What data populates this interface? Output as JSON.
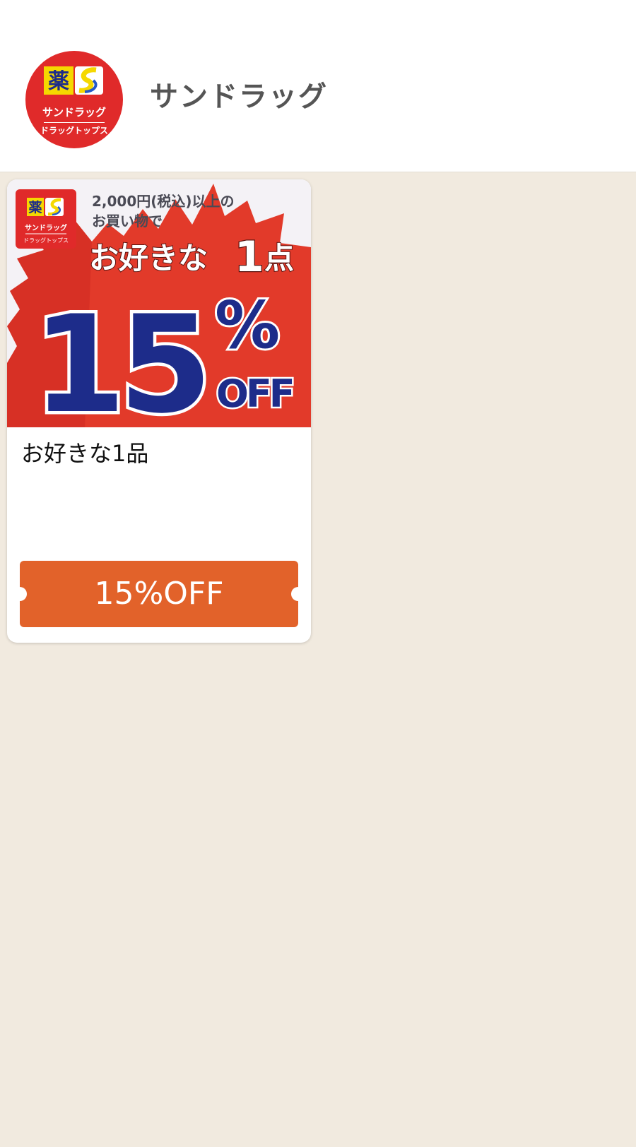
{
  "header": {
    "logo": {
      "kanji": "薬",
      "brand": "サンドラッグ",
      "sub_brand": "ドラッグトップス"
    },
    "store_name": "サンドラッグ"
  },
  "coupon": {
    "banner": {
      "condition_line1": "2,000円(税込)以上の",
      "condition_line2": "お買い物で",
      "headline": "お好きな",
      "headline_number": "1",
      "headline_suffix": "点",
      "discount_number": "15",
      "discount_percent": "%",
      "discount_off": "OFF",
      "logo_kanji": "薬",
      "logo_brand": "サンドラッグ",
      "logo_sub": "ドラッグトップス"
    },
    "title": "お好きな1品",
    "ticket_label": "15%OFF"
  },
  "colors": {
    "background": "#f1eadf",
    "brand_red": "#e02a2a",
    "brand_yellow": "#f5d800",
    "discount_navy": "#1d2c8a",
    "ticket_orange": "#e2622a"
  }
}
